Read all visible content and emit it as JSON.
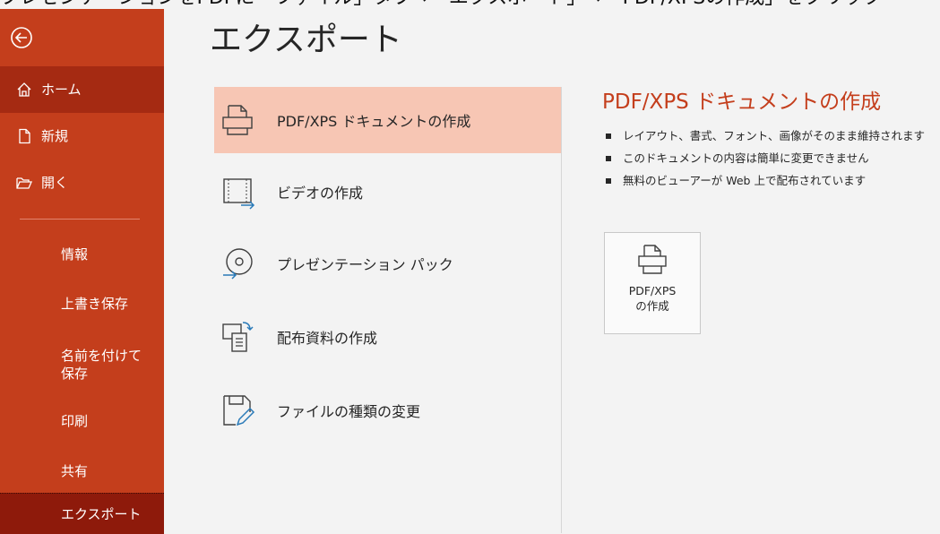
{
  "caption": "プレゼンテーションをPDFに「ファイル」タブ→「エクスポート」→「PDF/XPSの作成」をクリック",
  "sidebar": {
    "back_icon": "back-arrow-icon",
    "top_items": [
      {
        "label": "ホーム",
        "icon": "home-icon"
      },
      {
        "label": "新規",
        "icon": "new-document-icon"
      },
      {
        "label": "開く",
        "icon": "open-folder-icon"
      }
    ],
    "sub_items": [
      "情報",
      "上書き保存",
      "名前を付けて保存",
      "印刷",
      "共有",
      "エクスポート"
    ],
    "colors": {
      "background": "#c43e1c",
      "selected": "#8e1a0b",
      "home": "#a52a12"
    }
  },
  "main": {
    "title": "エクスポート",
    "options": [
      {
        "label": "PDF/XPS ドキュメントの作成",
        "icon": "pdf-printer-icon",
        "selected": true
      },
      {
        "label": "ビデオの作成",
        "icon": "video-icon",
        "selected": false
      },
      {
        "label": "プレゼンテーション パック",
        "icon": "cd-package-icon",
        "selected": false
      },
      {
        "label": "配布資料の作成",
        "icon": "handouts-icon",
        "selected": false
      },
      {
        "label": "ファイルの種類の変更",
        "icon": "change-file-type-icon",
        "selected": false
      }
    ],
    "detail": {
      "title": "PDF/XPS ドキュメントの作成",
      "bullets": [
        "レイアウト、書式、フォント、画像がそのまま維持されます",
        "このドキュメントの内容は簡単に変更できません",
        "無料のビューアーが Web 上で配布されています"
      ],
      "button_line1": "PDF/XPS",
      "button_line2": "の作成",
      "accent": "#c43e1c"
    }
  }
}
